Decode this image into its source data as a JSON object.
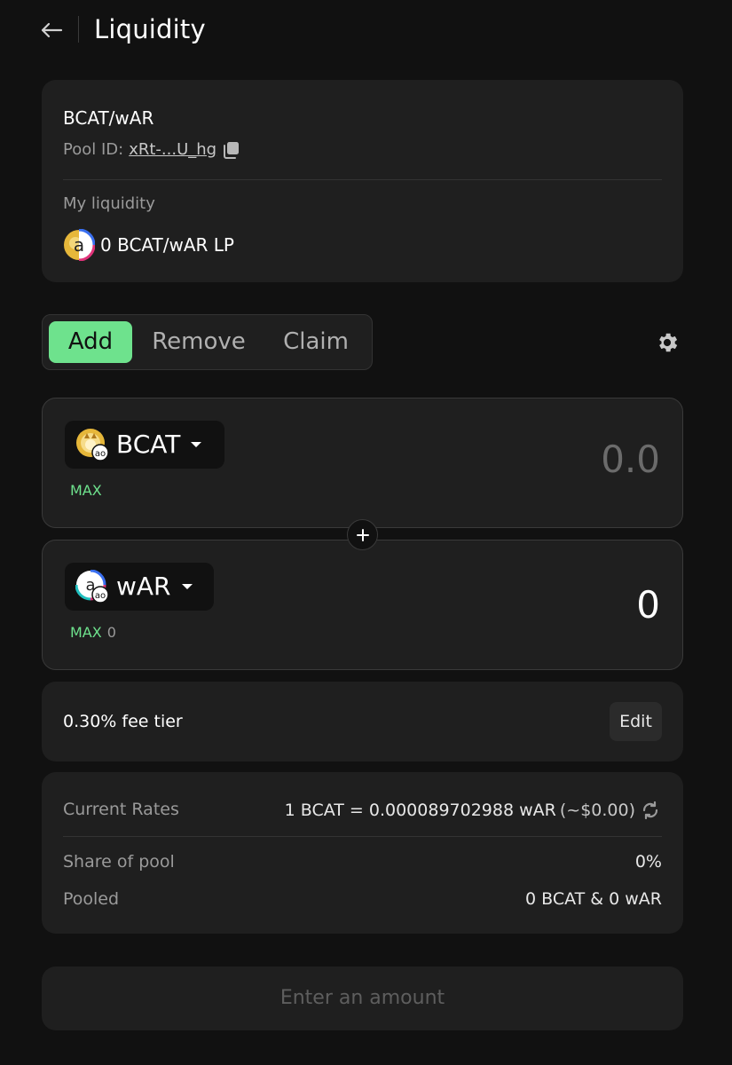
{
  "header": {
    "title": "Liquidity"
  },
  "pool": {
    "name": "BCAT/wAR",
    "id_label": "Pool ID:",
    "id_value": "xRt-...U_hg",
    "my_liquidity_label": "My liquidity",
    "lp_balance": "0 BCAT/wAR LP"
  },
  "tabs": [
    {
      "label": "Add",
      "active": true
    },
    {
      "label": "Remove",
      "active": false
    },
    {
      "label": "Claim",
      "active": false
    }
  ],
  "token_a": {
    "symbol": "BCAT",
    "max_label": "MAX",
    "balance": "",
    "amount_placeholder": "0.0",
    "amount_value": ""
  },
  "token_b": {
    "symbol": "wAR",
    "max_label": "MAX",
    "balance": "0",
    "amount_placeholder": "0.0",
    "amount_value": "0"
  },
  "fee": {
    "text": "0.30% fee tier",
    "edit_label": "Edit"
  },
  "rates": {
    "current_label": "Current Rates",
    "current_value": "1 BCAT = 0.000089702988 wAR",
    "current_usd": "(~$0.00)",
    "share_label": "Share of pool",
    "share_value": "0%",
    "pooled_label": "Pooled",
    "pooled_value": "0 BCAT & 0 wAR"
  },
  "submit": {
    "label": "Enter an amount"
  },
  "colors": {
    "background": "#111111",
    "card": "#1f1f1f",
    "accent": "#6ee28d",
    "muted_text": "#9a9a9a"
  },
  "icons": {
    "back": "arrow-left-icon",
    "copy": "copy-icon",
    "settings": "gear-icon",
    "plus": "plus-icon",
    "refresh": "refresh-icon",
    "dropdown": "caret-down-icon"
  }
}
